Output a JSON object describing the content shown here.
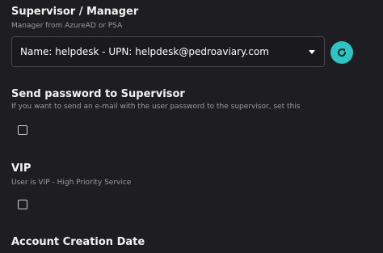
{
  "supervisor": {
    "label": "Supervisor / Manager",
    "help": "Manager from AzureAD or PSA",
    "selected_value": "Name: helpdesk - UPN: helpdesk@pedroaviary.com",
    "caret_icon": "caret-down-icon",
    "refresh_icon": "refresh-icon",
    "refresh_color": "#2ec4c4"
  },
  "send_password": {
    "label": "Send password to Supervisor",
    "help": "If you want to send an e-mail with the user password to the supervisor, set this",
    "checked": false
  },
  "vip": {
    "label": "VIP",
    "help": "User is VIP - High Priority Service",
    "checked": false
  },
  "account_creation": {
    "label": "Account Creation Date"
  }
}
